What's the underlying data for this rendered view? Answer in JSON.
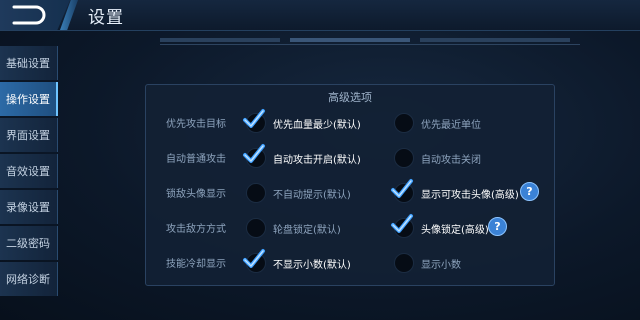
{
  "header": {
    "title": "设置"
  },
  "sidebar": {
    "items": [
      {
        "label": "基础设置"
      },
      {
        "label": "操作设置",
        "active": true
      },
      {
        "label": "界面设置"
      },
      {
        "label": "音效设置"
      },
      {
        "label": "录像设置"
      },
      {
        "label": "二级密码"
      },
      {
        "label": "网络诊断"
      }
    ]
  },
  "panel": {
    "title": "高级选项",
    "rows": [
      {
        "label": "优先攻击目标",
        "left": {
          "label": "优先血量最少(默认)",
          "checked": true
        },
        "right": {
          "label": "优先最近单位",
          "checked": false
        }
      },
      {
        "label": "自动普通攻击",
        "left": {
          "label": "自动攻击开启(默认)",
          "checked": true
        },
        "right": {
          "label": "自动攻击关闭",
          "checked": false
        }
      },
      {
        "label": "锁敌头像显示",
        "left": {
          "label": "不自动提示(默认)",
          "checked": false
        },
        "right": {
          "label": "显示可攻击头像(高级)",
          "checked": true,
          "help": true
        }
      },
      {
        "label": "攻击敌方方式",
        "left": {
          "label": "轮盘锁定(默认)",
          "checked": false
        },
        "right": {
          "label": "头像锁定(高级)",
          "checked": true,
          "help": true
        }
      },
      {
        "label": "技能冷却显示",
        "left": {
          "label": "不显示小数(默认)",
          "checked": true
        },
        "right": {
          "label": "显示小数",
          "checked": false
        }
      }
    ],
    "help_glyph": "?"
  },
  "colors": {
    "accent": "#2c6aa6",
    "check": "#3fa0ff",
    "help": "#3b82d6"
  }
}
